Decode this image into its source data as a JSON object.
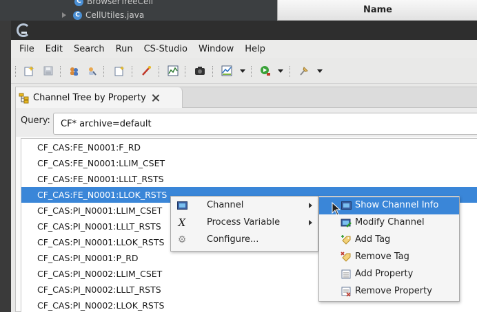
{
  "background": {
    "tree_items": [
      {
        "label": "BrowserTreeCell"
      },
      {
        "label": "CellUtiles.java"
      }
    ],
    "table_header": "Name"
  },
  "menubar": [
    "File",
    "Edit",
    "Search",
    "Run",
    "CS-Studio",
    "Window",
    "Help"
  ],
  "toolbar": {
    "icons": [
      "new-wizard-icon",
      "save-icon",
      "people-icon",
      "find-icon",
      "new-view-icon",
      "probe-icon",
      "chart-icon",
      "camera-icon",
      "databrowser-icon",
      "run-icon",
      "pin-icon"
    ]
  },
  "view": {
    "tab_label": "Channel Tree by Property",
    "query_label": "Query:",
    "query_value": "CF* archive=default"
  },
  "tree_rows": [
    "CF_CAS:FE_N0001:F_RD",
    "CF_CAS:FE_N0001:LLIM_CSET",
    "CF_CAS:FE_N0001:LLLT_RSTS",
    "CF_CAS:FE_N0001:LLOK_RSTS",
    "CF_CAS:PI_N0001:LLIM_CSET",
    "CF_CAS:PI_N0001:LLLT_RSTS",
    "CF_CAS:PI_N0001:LLOK_RSTS",
    "CF_CAS:PI_N0001:P_RD",
    "CF_CAS:PI_N0002:LLIM_CSET",
    "CF_CAS:PI_N0002:LLLT_RSTS",
    "CF_CAS:PI_N0002:LLOK_RSTS"
  ],
  "selected_row_index": 3,
  "context_menu": {
    "items": [
      {
        "label": "Channel",
        "icon": "monitor-icon",
        "submenu": true
      },
      {
        "label": "Process Variable",
        "icon": "x-icon",
        "submenu": true
      },
      {
        "label": "Configure...",
        "icon": "gear-icon",
        "submenu": false
      }
    ]
  },
  "channel_submenu": {
    "items": [
      {
        "label": "Show Channel Info",
        "icon": "monitor-icon"
      },
      {
        "label": "Modify Channel",
        "icon": "edit-channel-icon"
      },
      {
        "label": "Add Tag",
        "icon": "add-tag-icon"
      },
      {
        "label": "Remove Tag",
        "icon": "remove-tag-icon"
      },
      {
        "label": "Add Property",
        "icon": "add-property-icon"
      },
      {
        "label": "Remove Property",
        "icon": "remove-property-icon"
      }
    ]
  },
  "colors": {
    "selection": "#3a86d8",
    "titlebar": "#2e2e2e"
  }
}
